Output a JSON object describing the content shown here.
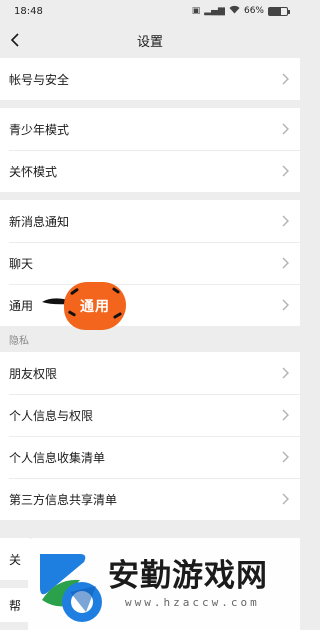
{
  "status_bar": {
    "time": "18:48",
    "battery_text": "66%",
    "battery_level": 0.66
  },
  "nav": {
    "title": "设置"
  },
  "groups": [
    {
      "items": [
        "帐号与安全"
      ]
    },
    {
      "items": [
        "青少年模式",
        "关怀模式"
      ]
    },
    {
      "items": [
        "新消息通知",
        "聊天",
        "通用"
      ]
    }
  ],
  "privacy": {
    "section_label": "隐私",
    "items": [
      "朋友权限",
      "个人信息与权限",
      "个人信息收集清单",
      "第三方信息共享清单"
    ]
  },
  "partial_items": [
    "关",
    "帮"
  ],
  "sticker": {
    "text": "通用",
    "color": "#f3641c"
  },
  "watermark": {
    "title": "安勤游戏网",
    "url": "www.hzaccw.com"
  },
  "colors": {
    "background": "#ededed",
    "row": "#ffffff",
    "chevron": "#b2b2b2"
  }
}
